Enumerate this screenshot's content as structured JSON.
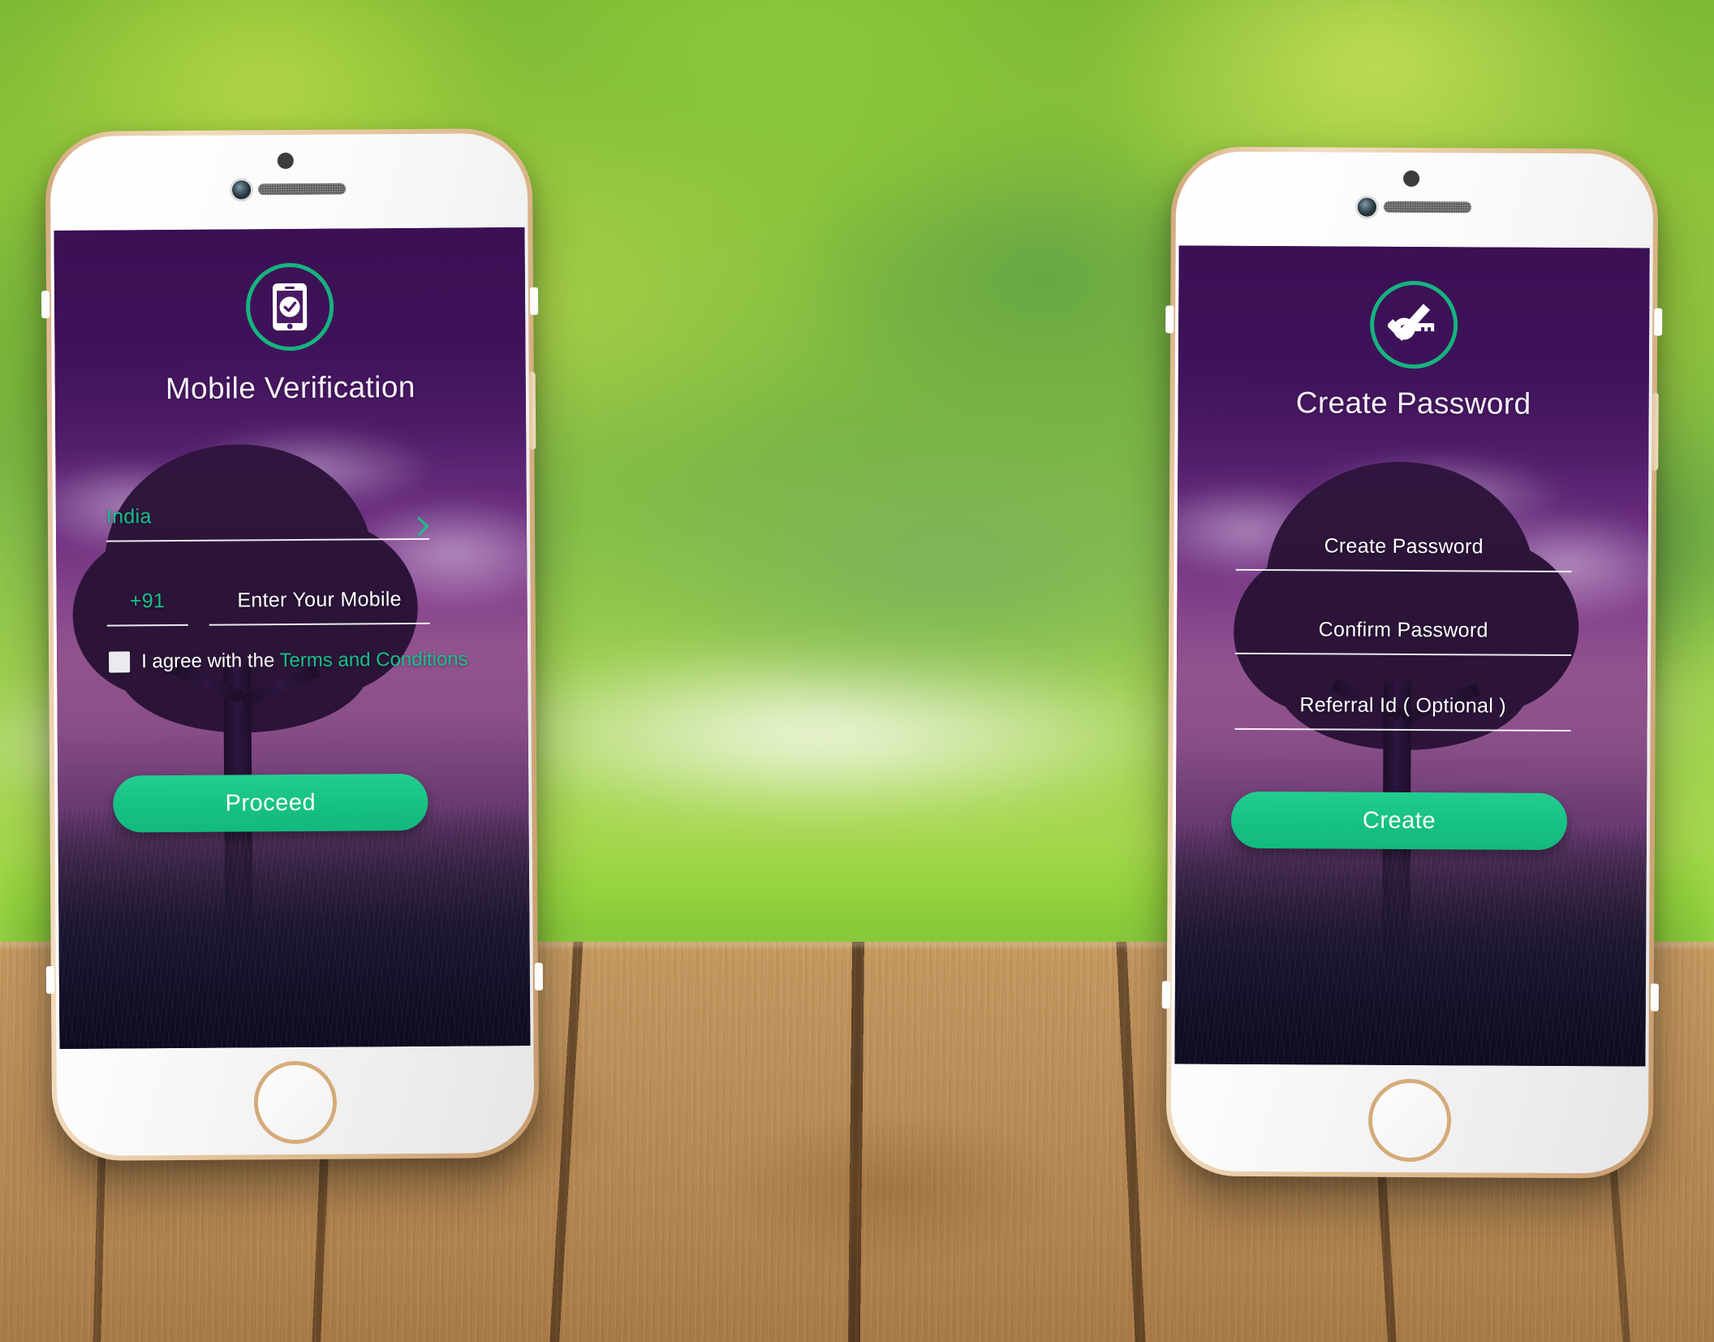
{
  "scene": {
    "background_description": "blurred green garden with wooden table",
    "table_color": "#bb8d58",
    "foliage_color": "#8cc43a"
  },
  "theme": {
    "accent_teal": "#16c08a",
    "ring_teal": "#16b37e",
    "screen_purple_top": "#3f1159",
    "screen_purple_mid": "#93538f",
    "screen_dark_bottom": "#0e0c22",
    "text_white": "#ffffff",
    "device_body": "#ffffff",
    "device_edge_gold": "#d5ab79"
  },
  "devices": [
    {
      "name": "left-phone",
      "screen": {
        "name": "mobile-verification",
        "icon": "mobile-check-icon",
        "title": "Mobile Verification",
        "fields": [
          {
            "name": "country-select",
            "value": "India",
            "style": "teal",
            "trailing_icon": "chevron-right-icon"
          },
          {
            "name": "country-code",
            "value": "+91",
            "style": "teal"
          },
          {
            "name": "mobile-number-input",
            "placeholder": "Enter Your Mobile",
            "style": "white"
          }
        ],
        "consent": {
          "checked": false,
          "text_prefix": "I agree with the ",
          "link_text": "Terms and Conditions"
        },
        "cta": {
          "name": "proceed-button",
          "label": "Proceed"
        }
      }
    },
    {
      "name": "right-phone",
      "screen": {
        "name": "create-password",
        "icon": "key-check-icon",
        "title": "Create Password",
        "fields": [
          {
            "name": "create-password-input",
            "placeholder": "Create Password",
            "style": "white"
          },
          {
            "name": "confirm-password-input",
            "placeholder": "Confirm Password",
            "style": "white"
          },
          {
            "name": "referral-id-input",
            "placeholder": "Referral Id ( Optional )",
            "style": "white"
          }
        ],
        "cta": {
          "name": "create-button",
          "label": "Create"
        }
      }
    }
  ]
}
